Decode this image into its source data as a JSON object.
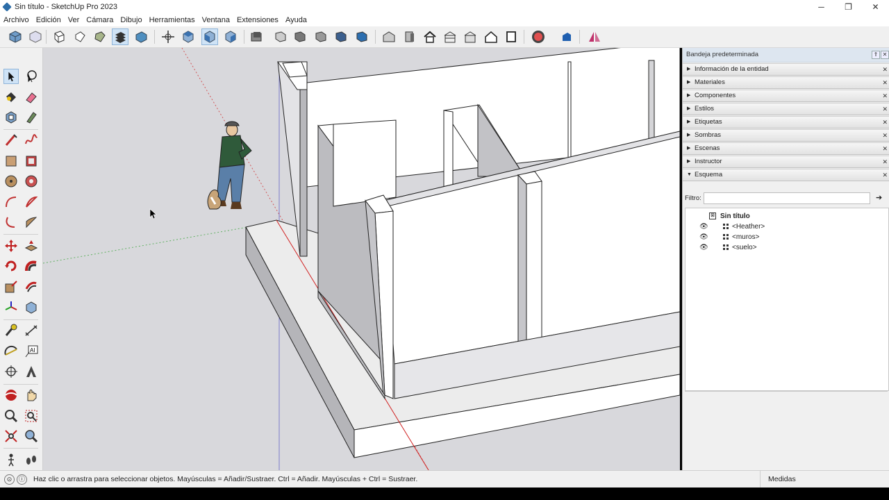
{
  "window": {
    "title": "Sin título - SketchUp Pro 2023",
    "controls": [
      "─",
      "❐",
      "✕"
    ]
  },
  "menu": [
    "Archivo",
    "Edición",
    "Ver",
    "Cámara",
    "Dibujo",
    "Herramientas",
    "Ventana",
    "Extensiones",
    "Ayuda"
  ],
  "tray": {
    "title": "Bandeja predeterminada",
    "panels": [
      {
        "label": "Información de la entidad",
        "expanded": false
      },
      {
        "label": "Materiales",
        "expanded": false
      },
      {
        "label": "Componentes",
        "expanded": false
      },
      {
        "label": "Estilos",
        "expanded": false
      },
      {
        "label": "Etiquetas",
        "expanded": false
      },
      {
        "label": "Sombras",
        "expanded": false
      },
      {
        "label": "Escenas",
        "expanded": false
      },
      {
        "label": "Instructor",
        "expanded": false
      },
      {
        "label": "Esquema",
        "expanded": true
      }
    ],
    "filter": {
      "label": "Filtro:",
      "value": ""
    },
    "outliner": {
      "root": "Sin título",
      "items": [
        "<Heather>",
        "<muros>",
        "<suelo>"
      ]
    }
  },
  "statusbar": {
    "message": "Haz clic o arrastra para seleccionar objetos. Mayúsculas = Añadir/Sustraer. Ctrl = Añadir. Mayúsculas + Ctrl = Sustraer.",
    "measurements_label": "Medidas"
  },
  "colors": {
    "viewport_bg": "#d8d8dc",
    "wall_face": "#ffffff",
    "wall_side": "#b9b9bd",
    "axis_red": "#d02020",
    "axis_green": "#2ea02e",
    "axis_blue": "#2020c0",
    "tray_header": "#dde6f0"
  },
  "icons": {
    "toolbar": [
      "iso-view-icon",
      "top-view-icon",
      "front-view-icon",
      "right-view-icon",
      "back-view-icon",
      "left-view-icon",
      "bottom-view-icon",
      "orbit-icon",
      "pan-icon",
      "zoom-icon",
      "zoom-window-icon",
      "zoom-extents-icon",
      "xray-icon",
      "back-edges-icon",
      "wireframe-icon",
      "hidden-line-icon",
      "shaded-icon",
      "shaded-textures-icon",
      "monochrome-icon",
      "warehouse-icon",
      "extension-icon",
      "section-plane-icon",
      "section-display-icon",
      "section-cuts-icon",
      "section-fill-icon",
      "house-icon",
      "solid-tools-icon",
      "layout-icon",
      "ruby-icon",
      "style-builder-icon",
      "mirror-icon"
    ],
    "lefttools": [
      "select-icon",
      "lasso-icon",
      "paint-bucket-icon",
      "eraser-icon",
      "component-icon",
      "tag-icon",
      "line-icon",
      "freehand-icon",
      "rectangle-icon",
      "rotated-rectangle-icon",
      "circle-icon",
      "polygon-icon",
      "arc-icon",
      "two-point-arc-icon",
      "three-point-arc-icon",
      "pie-icon",
      "move-icon",
      "push-pull-icon",
      "rotate-icon",
      "follow-me-icon",
      "scale-icon",
      "offset-icon",
      "axes-icon",
      "solid-icon",
      "tape-measure-icon",
      "dimension-icon",
      "protractor-icon",
      "text-icon",
      "axes-tool-icon",
      "three-d-text-icon",
      "orbit-tool-icon",
      "pan-tool-icon",
      "zoom-tool-icon",
      "zoom-window-tool-icon",
      "zoom-extents-tool-icon",
      "previous-view-icon",
      "position-camera-icon",
      "walk-icon"
    ]
  }
}
